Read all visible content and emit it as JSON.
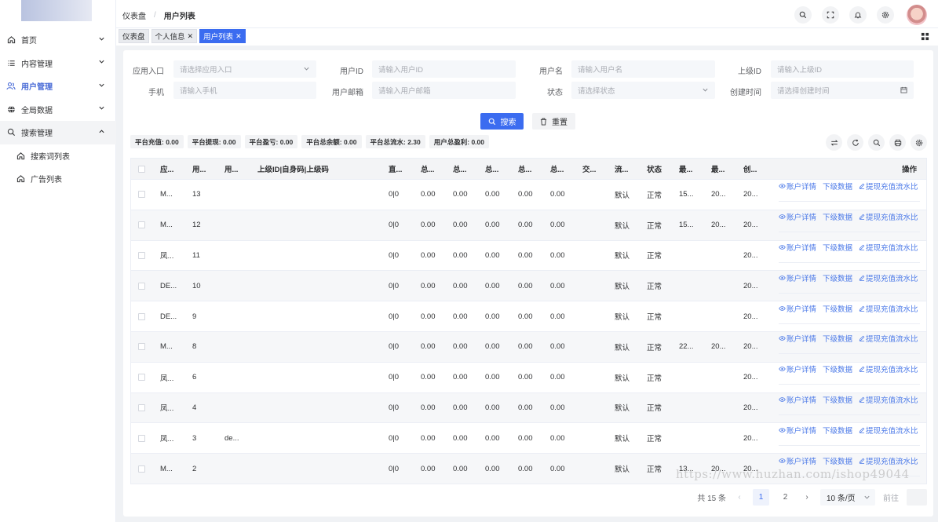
{
  "sidebar": {
    "items": [
      {
        "label": "首页",
        "icon": "home-icon"
      },
      {
        "label": "内容管理",
        "icon": "list-icon"
      },
      {
        "label": "用户管理",
        "icon": "users-icon"
      },
      {
        "label": "全局数据",
        "icon": "globe-icon"
      },
      {
        "label": "搜索管理",
        "icon": "search-icon"
      },
      {
        "label": "搜索词列表",
        "icon": "home-icon"
      },
      {
        "label": "广告列表",
        "icon": "home-icon"
      }
    ]
  },
  "header": {
    "breadcrumb": [
      "仪表盘",
      "用户列表"
    ]
  },
  "tabs": [
    {
      "label": "仪表盘"
    },
    {
      "label": "个人信息"
    },
    {
      "label": "用户列表"
    }
  ],
  "form": {
    "app_entry": {
      "label": "应用入口",
      "placeholder": "请选择应用入口"
    },
    "user_id": {
      "label": "用户ID",
      "placeholder": "请输入用户ID"
    },
    "username": {
      "label": "用户名",
      "placeholder": "请输入用户名"
    },
    "parent_id": {
      "label": "上级ID",
      "placeholder": "请输入上级ID"
    },
    "phone": {
      "label": "手机",
      "placeholder": "请输入手机"
    },
    "email": {
      "label": "用户邮箱",
      "placeholder": "请输入用户邮箱"
    },
    "status": {
      "label": "状态",
      "placeholder": "请选择状态"
    },
    "created": {
      "label": "创建时间",
      "placeholder": "请选择创建时间"
    },
    "search_label": "搜索",
    "reset_label": "重置"
  },
  "stats": [
    "平台充值: 0.00",
    "平台提现: 0.00",
    "平台盈亏: 0.00",
    "平台总余额: 0.00",
    "平台总流水: 2.30",
    "用户总盈利: 0.00"
  ],
  "table": {
    "columns": [
      "应...",
      "用...",
      "用...",
      "上级ID|自身码|上级码",
      "直...",
      "总...",
      "总...",
      "总...",
      "总...",
      "总...",
      "交...",
      "流...",
      "状态",
      "最...",
      "最...",
      "创...",
      "操作"
    ],
    "rows": [
      [
        "M...",
        "13",
        "",
        "",
        "0|0",
        "0.00",
        "0.00",
        "0.00",
        "0.00",
        "0.00",
        "",
        "默认",
        "正常",
        "15...",
        "20...",
        "20..."
      ],
      [
        "M...",
        "12",
        "",
        "",
        "0|0",
        "0.00",
        "0.00",
        "0.00",
        "0.00",
        "0.00",
        "",
        "默认",
        "正常",
        "15...",
        "20...",
        "20..."
      ],
      [
        "凤...",
        "11",
        "",
        "",
        "0|0",
        "0.00",
        "0.00",
        "0.00",
        "0.00",
        "0.00",
        "",
        "默认",
        "正常",
        "",
        "",
        "20..."
      ],
      [
        "DE...",
        "10",
        "",
        "",
        "0|0",
        "0.00",
        "0.00",
        "0.00",
        "0.00",
        "0.00",
        "",
        "默认",
        "正常",
        "",
        "",
        "20..."
      ],
      [
        "DE...",
        "9",
        "",
        "",
        "0|0",
        "0.00",
        "0.00",
        "0.00",
        "0.00",
        "0.00",
        "",
        "默认",
        "正常",
        "",
        "",
        "20..."
      ],
      [
        "M...",
        "8",
        "",
        "",
        "0|0",
        "0.00",
        "0.00",
        "0.00",
        "0.00",
        "0.00",
        "",
        "默认",
        "正常",
        "22...",
        "20...",
        "20..."
      ],
      [
        "凤...",
        "6",
        "",
        "",
        "0|0",
        "0.00",
        "0.00",
        "0.00",
        "0.00",
        "0.00",
        "",
        "默认",
        "正常",
        "",
        "",
        "20..."
      ],
      [
        "凤...",
        "4",
        "",
        "",
        "0|0",
        "0.00",
        "0.00",
        "0.00",
        "0.00",
        "0.00",
        "",
        "默认",
        "正常",
        "",
        "",
        "20..."
      ],
      [
        "凤...",
        "3",
        "de...",
        "",
        "0|0",
        "0.00",
        "0.00",
        "0.00",
        "0.00",
        "0.00",
        "",
        "默认",
        "正常",
        "",
        "",
        "20..."
      ],
      [
        "M...",
        "2",
        "",
        "",
        "0|0",
        "0.00",
        "0.00",
        "0.00",
        "0.00",
        "0.00",
        "",
        "默认",
        "正常",
        "13...",
        "20...",
        "20..."
      ]
    ],
    "actions": [
      "账户详情",
      "下级数据",
      "提现充值流水比"
    ]
  },
  "pagination": {
    "total": "共 15 条",
    "pages": [
      "1",
      "2"
    ],
    "page_size": "10 条/页",
    "goto": "前往"
  },
  "watermark": "https://www.huzhan.com/ishop49044",
  "colors": {
    "primary": "#3b6cf0",
    "link": "#4c7ae8",
    "active_menu": "#4669d6"
  }
}
